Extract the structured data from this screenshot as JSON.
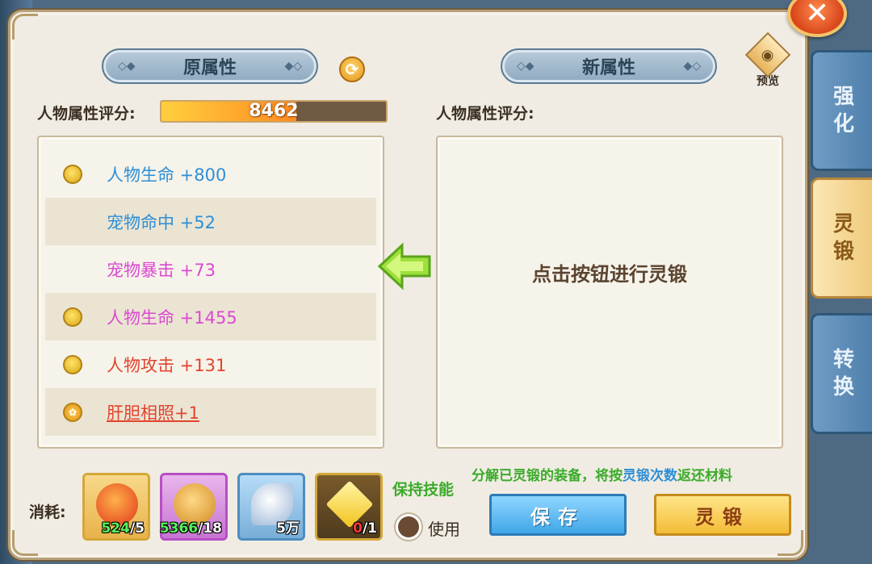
{
  "close_icon": "close-icon",
  "left_panel": {
    "title": "原属性",
    "score_label": "人物属性评分:",
    "score_value": "8462",
    "score_fill_fraction": 0.6,
    "attributes": [
      {
        "text": "人物生命 +800",
        "color": "blue",
        "icon": "gold-dot-icon"
      },
      {
        "text": "宠物命中 +52",
        "color": "blue",
        "icon": null
      },
      {
        "text": "宠物暴击 +73",
        "color": "pink",
        "icon": null
      },
      {
        "text": "人物生命 +1455",
        "color": "pink",
        "icon": "gold-dot-icon"
      },
      {
        "text": "人物攻击 +131",
        "color": "red",
        "icon": "gold-dot-icon"
      },
      {
        "text": "肝胆相照+1",
        "color": "red",
        "icon": "paw-icon",
        "underline": true
      }
    ]
  },
  "right_panel": {
    "title": "新属性",
    "score_label": "人物属性评分:",
    "placeholder": "点击按钮进行灵锻",
    "preview_label": "预览"
  },
  "tabs": [
    {
      "label": "强\n化",
      "active": false
    },
    {
      "label": "灵\n锻",
      "active": true
    },
    {
      "label": "转\n换",
      "active": false
    }
  ],
  "cost": {
    "label": "消耗:",
    "items": [
      {
        "name": "paw-orb-icon",
        "have": "524",
        "need": "/5",
        "low": false
      },
      {
        "name": "swirl-stone-icon",
        "have": "5366",
        "need": "/18",
        "low": false
      },
      {
        "name": "leaf-crystal-icon",
        "have": "",
        "need": "5万",
        "low": false
      },
      {
        "name": "gold-gem-icon",
        "have": "0",
        "need": "/1",
        "low": true
      }
    ]
  },
  "keep_skill": {
    "label": "保持技能",
    "use_label": "使用"
  },
  "notice": {
    "prefix": "分解已灵锻的装备，将按",
    "highlight": "灵锻次数",
    "suffix": "返还材料"
  },
  "buttons": {
    "save": "保存",
    "forge": "灵锻"
  }
}
